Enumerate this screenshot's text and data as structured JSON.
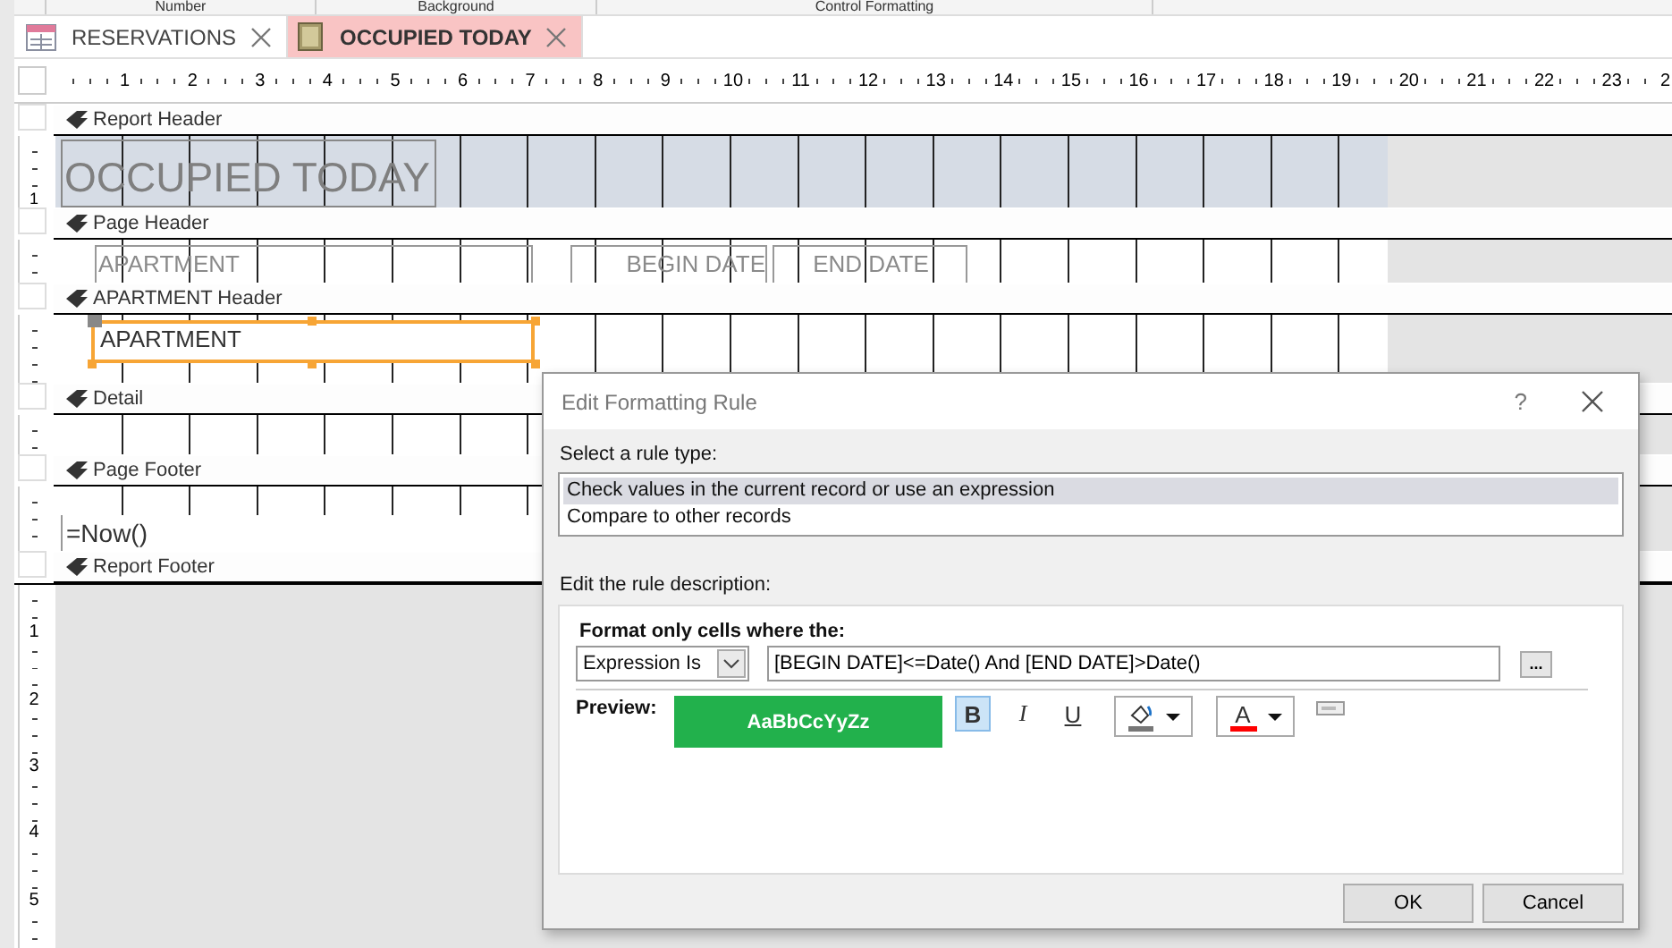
{
  "ribbon_groups": [
    "Number",
    "Background",
    "Control Formatting"
  ],
  "document_tabs": [
    {
      "label": "RESERVATIONS",
      "kind": "table",
      "selected": false
    },
    {
      "label": "OCCUPIED TODAY",
      "kind": "report",
      "selected": true
    }
  ],
  "ruler_marks": [
    "1",
    "2",
    "3",
    "4",
    "5",
    "6",
    "7",
    "8",
    "9",
    "10",
    "11",
    "12",
    "13",
    "14",
    "15",
    "16",
    "17",
    "18",
    "19",
    "20",
    "21",
    "22",
    "23",
    "2"
  ],
  "sections": [
    {
      "title": "Report Header",
      "shaded": true,
      "ruler_marks": [
        "1"
      ],
      "controls": [
        {
          "kind": "title_label",
          "text": "OCCUPIED TODAY",
          "selected": false
        }
      ]
    },
    {
      "title": "Page Header",
      "shaded": false,
      "controls": [
        {
          "kind": "label",
          "text": "APARTMENT",
          "selected": false
        },
        {
          "kind": "label",
          "text": "BEGIN DATE",
          "selected": false
        },
        {
          "kind": "label",
          "text": "END DATE",
          "selected": false
        }
      ]
    },
    {
      "title": "APARTMENT Header",
      "shaded": false,
      "controls": [
        {
          "kind": "textbox",
          "text": "APARTMENT",
          "selected": true
        }
      ]
    },
    {
      "title": "Detail",
      "shaded": false
    },
    {
      "title": "Page Footer",
      "shaded": false,
      "controls": [
        {
          "kind": "textbox",
          "text": "=Now()",
          "selected": false
        }
      ]
    },
    {
      "title": "Report Footer"
    }
  ],
  "lower_ruler_marks": [
    "1",
    "2",
    "3",
    "4",
    "5"
  ],
  "dialog": {
    "title": "Edit Formatting Rule",
    "help": "?",
    "rule_type_label": "Select a rule type:",
    "rule_types": [
      {
        "label": "Check values in the current record or use an expression",
        "selected": true
      },
      {
        "label": "Compare to other records",
        "selected": false
      }
    ],
    "description_label": "Edit the rule description:",
    "condition_label": "Format only cells where the:",
    "condition_type": "Expression Is",
    "expression": "[BEGIN DATE]<=Date() And [END DATE]>Date()",
    "builder_button": "...",
    "preview_label": "Preview:",
    "preview_text": "AaBbCcYyZz",
    "format_buttons": [
      {
        "kind": "bold",
        "label": "B",
        "selected": true
      },
      {
        "kind": "italic",
        "label": "I",
        "selected": false
      },
      {
        "kind": "underline",
        "label": "U",
        "selected": false
      },
      {
        "kind": "fill_color"
      },
      {
        "kind": "font_color",
        "label": "A"
      },
      {
        "kind": "enable"
      }
    ],
    "buttons": [
      "OK",
      "Cancel"
    ]
  }
}
